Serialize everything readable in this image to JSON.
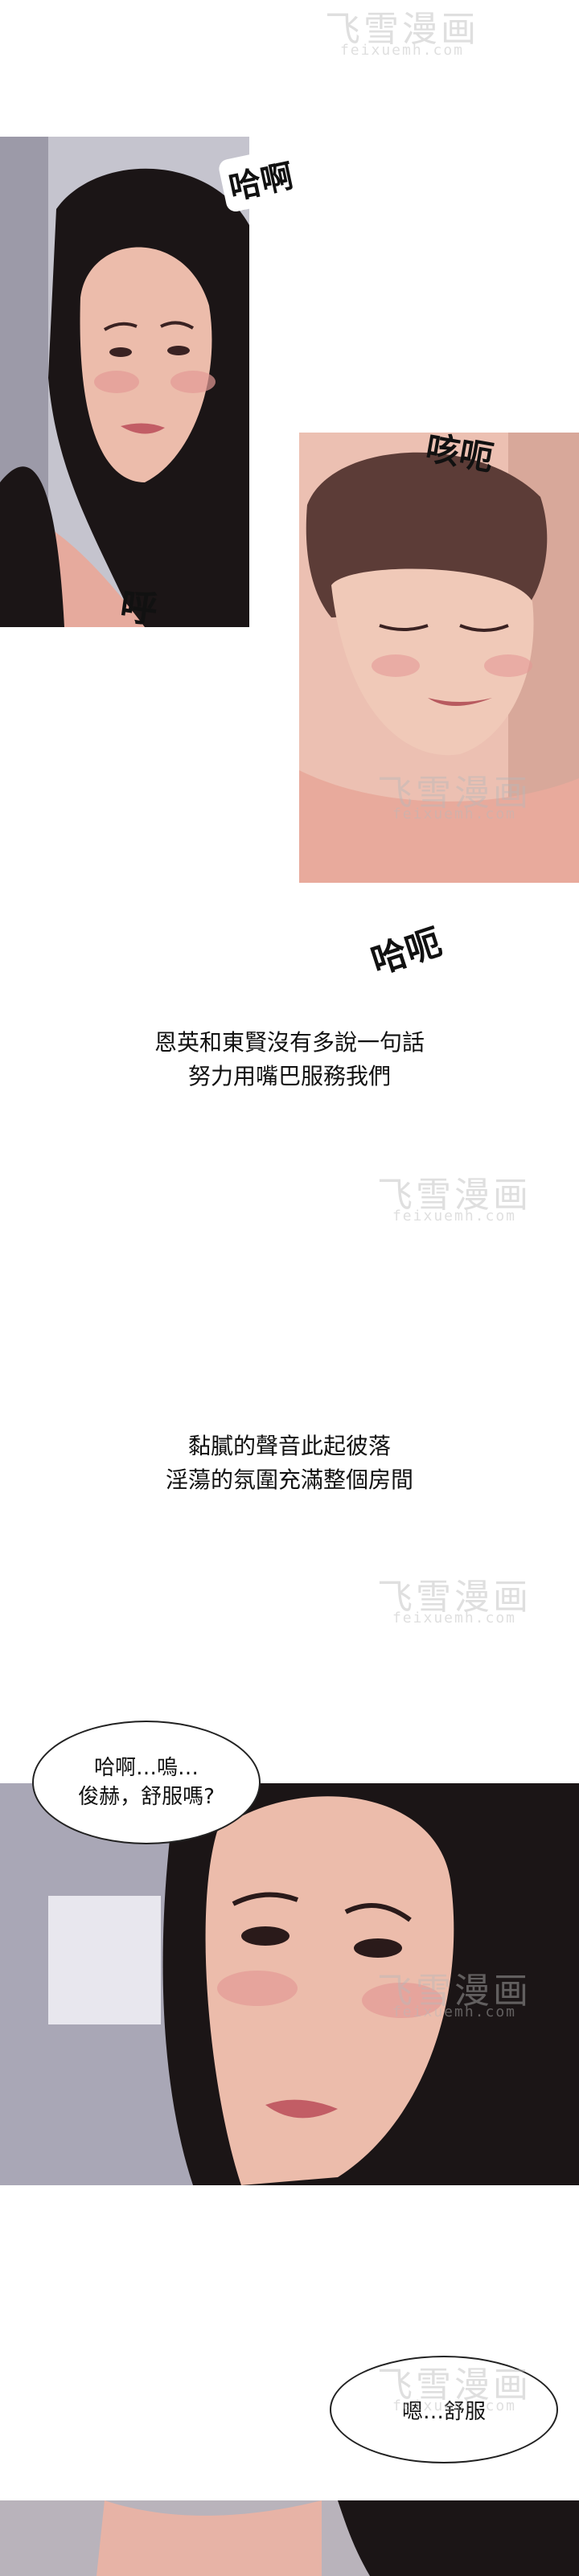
{
  "watermark": {
    "title": "飞雪漫画",
    "subtitle": "feixuemh.com"
  },
  "sfx": {
    "haa": "哈啊",
    "hu": "呼",
    "kehe": "咳呃",
    "hae": "哈呃"
  },
  "narration": {
    "line1": "恩英和東賢沒有多說一句話",
    "line2": "努力用嘴巴服務我們",
    "line3": "黏膩的聲音此起彼落",
    "line4": "淫蕩的氛圍充滿整個房間"
  },
  "dialogue": {
    "bubble1_line1": "哈啊…嗚…",
    "bubble1_line2": "俊赫，舒服嗎?",
    "bubble2": "嗯…舒服"
  },
  "colors": {
    "skin": "#e9b5a6",
    "hair_dark": "#1a1516",
    "hair_brown": "#5a3b36",
    "blush": "#d77a7a",
    "bg_grey": "#bcbcc6"
  }
}
